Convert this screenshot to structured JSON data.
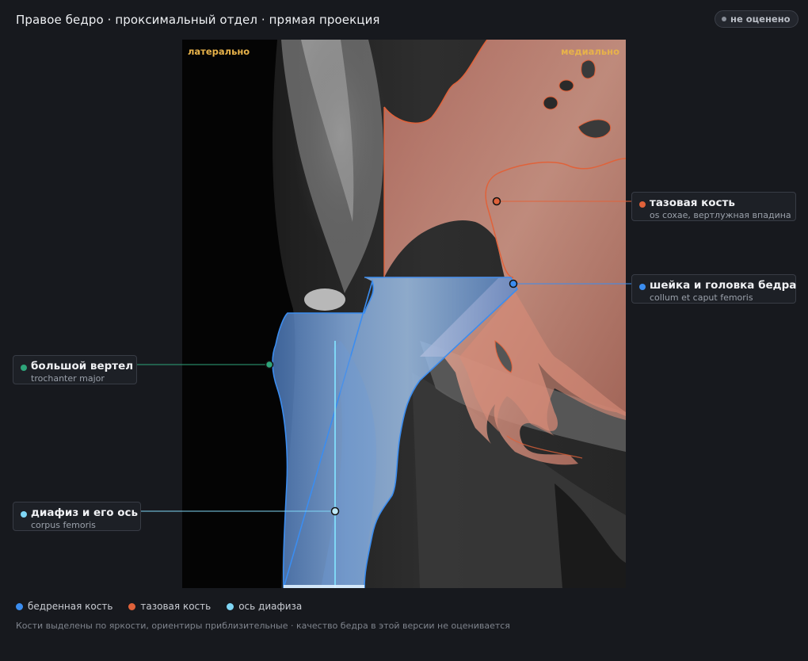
{
  "header": {
    "title": "Правое бедро · проксимальный отдел · прямая проекция",
    "status": "не оценено"
  },
  "viewer": {
    "orientation_left": "латерально",
    "orientation_right": "медиально"
  },
  "labels": {
    "pelvis": {
      "name": "тазовая кость",
      "sub": "os coxae, вертлужная впадина",
      "color": "#e0623a"
    },
    "neck": {
      "name": "шейка и головка бедра",
      "sub": "collum et caput femoris",
      "color": "#3b8df0"
    },
    "trochanter": {
      "name": "большой вертел",
      "sub": "trochanter major",
      "color": "#2ea57a"
    },
    "shaft": {
      "name": "диафиз и его ось",
      "sub": "corpus femoris",
      "color": "#7fd6f5"
    }
  },
  "legend": {
    "items": [
      {
        "label": "бедренная кость",
        "color": "#3b8df0"
      },
      {
        "label": "тазовая кость",
        "color": "#e0623a"
      },
      {
        "label": "ось диафиза",
        "color": "#7fd6f5"
      }
    ]
  },
  "footnote": "Кости выделены по яркости, ориентиры приблизительные · качество бедра в этой версии не оценивается"
}
